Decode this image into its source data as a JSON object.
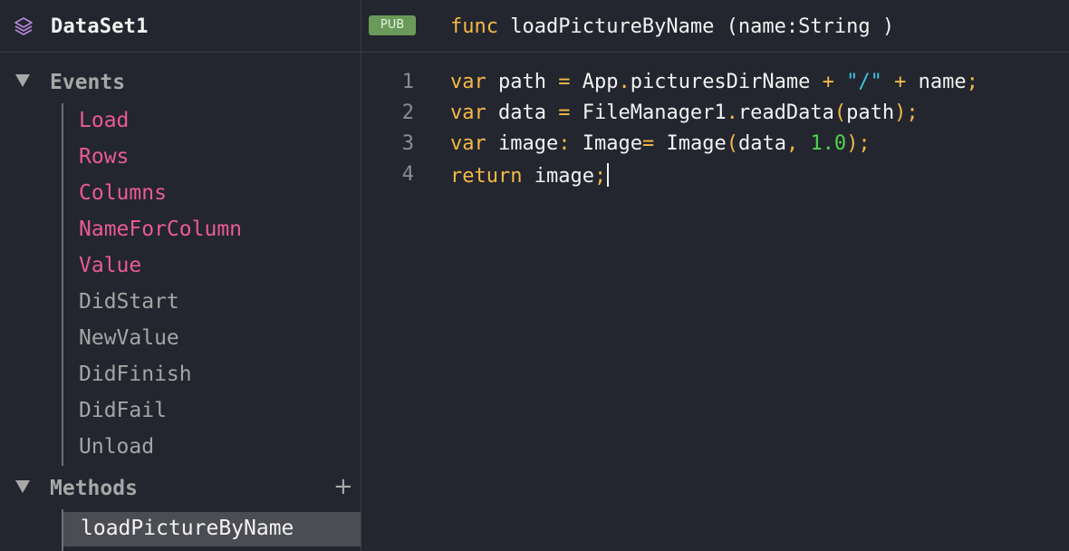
{
  "header": {
    "dataset_title": "DataSet1",
    "pub_badge": "PUB",
    "signature": {
      "keyword": "func",
      "name": "loadPictureByName",
      "params": " (name:String )"
    }
  },
  "sidebar": {
    "events_label": "Events",
    "events": [
      {
        "label": "Load",
        "state": "active"
      },
      {
        "label": "Rows",
        "state": "active"
      },
      {
        "label": "Columns",
        "state": "active"
      },
      {
        "label": "NameForColumn",
        "state": "active"
      },
      {
        "label": "Value",
        "state": "active"
      },
      {
        "label": "DidStart",
        "state": "inactive"
      },
      {
        "label": "NewValue",
        "state": "inactive"
      },
      {
        "label": "DidFinish",
        "state": "inactive"
      },
      {
        "label": "DidFail",
        "state": "inactive"
      },
      {
        "label": "Unload",
        "state": "inactive"
      }
    ],
    "methods_label": "Methods",
    "add_symbol": "+",
    "methods": [
      {
        "label": "loadPictureByName",
        "selected": true
      }
    ]
  },
  "editor": {
    "line_numbers": [
      "1",
      "2",
      "3",
      "4"
    ],
    "lines": [
      [
        {
          "t": "var",
          "c": "k"
        },
        {
          "t": " path ",
          "c": ""
        },
        {
          "t": "=",
          "c": "p"
        },
        {
          "t": " App",
          "c": ""
        },
        {
          "t": ".",
          "c": "p"
        },
        {
          "t": "picturesDirName ",
          "c": ""
        },
        {
          "t": "+",
          "c": "p"
        },
        {
          "t": " ",
          "c": ""
        },
        {
          "t": "\"/\"",
          "c": "s"
        },
        {
          "t": " ",
          "c": ""
        },
        {
          "t": "+",
          "c": "p"
        },
        {
          "t": " name",
          "c": ""
        },
        {
          "t": ";",
          "c": "p"
        }
      ],
      [
        {
          "t": "var",
          "c": "k"
        },
        {
          "t": " data ",
          "c": ""
        },
        {
          "t": "=",
          "c": "p"
        },
        {
          "t": " FileManager1",
          "c": ""
        },
        {
          "t": ".",
          "c": "p"
        },
        {
          "t": "readData",
          "c": ""
        },
        {
          "t": "(",
          "c": "p"
        },
        {
          "t": "path",
          "c": ""
        },
        {
          "t": ");",
          "c": "p"
        }
      ],
      [
        {
          "t": "var",
          "c": "k"
        },
        {
          "t": " image",
          "c": ""
        },
        {
          "t": ":",
          "c": "p"
        },
        {
          "t": " Image",
          "c": ""
        },
        {
          "t": "=",
          "c": "p"
        },
        {
          "t": " Image",
          "c": ""
        },
        {
          "t": "(",
          "c": "p"
        },
        {
          "t": "data",
          "c": ""
        },
        {
          "t": ",",
          "c": "p"
        },
        {
          "t": " ",
          "c": ""
        },
        {
          "t": "1.0",
          "c": "n"
        },
        {
          "t": ");",
          "c": "p"
        }
      ],
      [
        {
          "t": "return",
          "c": "k"
        },
        {
          "t": " image",
          "c": ""
        },
        {
          "t": ";",
          "c": "p"
        }
      ]
    ]
  },
  "colors": {
    "background": "#23262e",
    "active_event": "#e85a98",
    "inactive_event": "#a5a5a5",
    "keyword": "#f5b947",
    "string": "#3ec5e6",
    "number": "#4fd44f",
    "pub_badge": "#6a9a5a",
    "selected_row": "#4b4d53"
  }
}
